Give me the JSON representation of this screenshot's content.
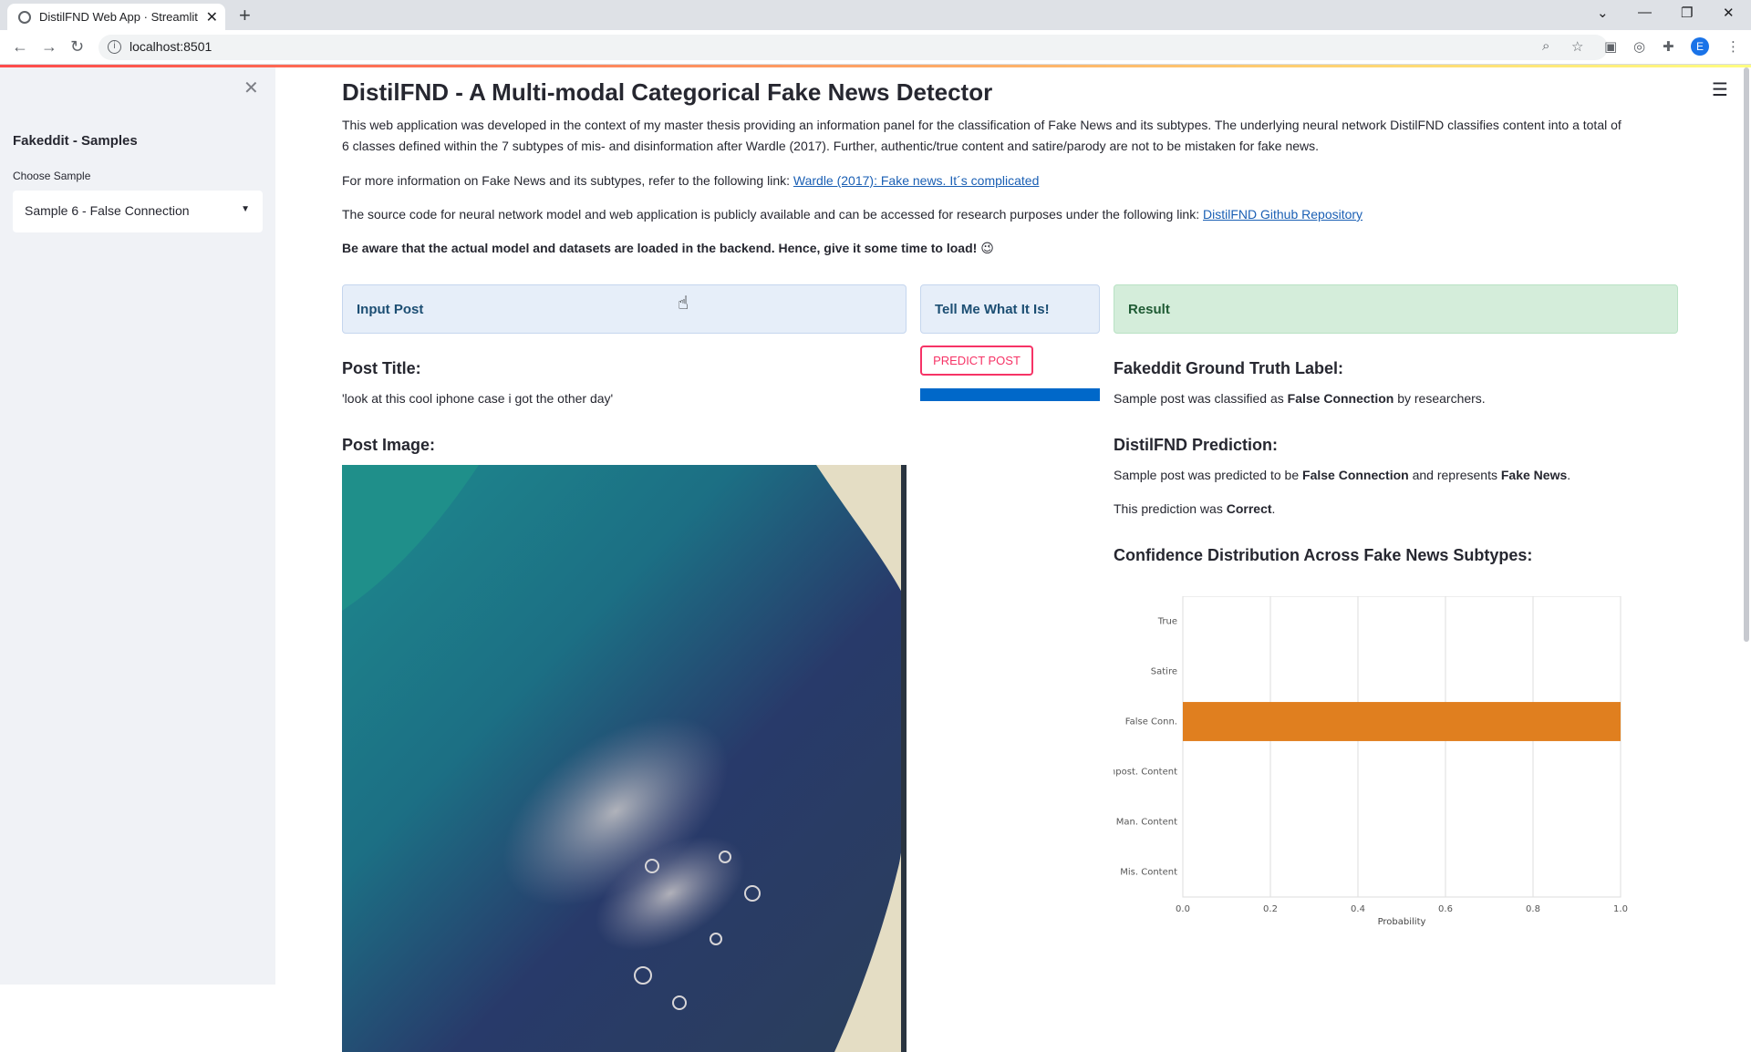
{
  "browser": {
    "tab_title": "DistilFND Web App · Streamlit",
    "url": "localhost:8501",
    "profile_initial": "E"
  },
  "sidebar": {
    "title": "Fakeddit - Samples",
    "select_label": "Choose Sample",
    "selected_value": "Sample 6 - False Connection"
  },
  "main": {
    "title": "DistilFND - A Multi-modal Categorical Fake News Detector",
    "intro_line1": "This web application was developed in the context of my master thesis providing an information panel for the classification of Fake News and its subtypes. The underlying neural network DistilFND classifies content into a total of",
    "intro_line2": "6 classes defined within the 7 subtypes of mis- and disinformation after Wardle (2017). Further, authentic/true content and satire/parody are not to be mistaken for fake news.",
    "more_info_text": "For more information on Fake News and its subtypes, refer to the following link:",
    "more_info_link": "Wardle (2017): Fake news. It´s complicated",
    "source_text": "The source code for neural network model and web application is publicly available and can be accessed for research purposes under the following link:",
    "source_link": "DistilFND Github Repository",
    "warning": "Be aware that the actual model and datasets are loaded in the backend. Hence, give it some time to load! 😉"
  },
  "panels": {
    "input": "Input Post",
    "tell": "Tell Me What It Is!",
    "result": "Result"
  },
  "post": {
    "title_heading": "Post Title:",
    "title_value": "'look at this cool iphone case i got the other day'",
    "image_heading": "Post Image:"
  },
  "predict": {
    "button_label": "PREDICT POST",
    "progress": 1.0
  },
  "result": {
    "truth_heading": "Fakeddit Ground Truth Label:",
    "truth_prefix": "Sample post was classified as ",
    "truth_label": "False Connection",
    "truth_suffix": " by researchers.",
    "prediction_heading": "DistilFND Prediction:",
    "pred_prefix": "Sample post was predicted to be ",
    "pred_label": "False Connection",
    "pred_mid": " and represents ",
    "pred_class": "Fake News",
    "pred_end": ".",
    "correct_prefix": "This prediction was ",
    "correct_value": "Correct",
    "correct_end": ".",
    "confidence_heading": "Confidence Distribution Across Fake News Subtypes:"
  },
  "chart_data": {
    "type": "bar",
    "orientation": "horizontal",
    "categories": [
      "True",
      "Satire",
      "False Conn.",
      "Impost. Content",
      "Man. Content",
      "Mis. Content"
    ],
    "values": [
      0.0,
      0.0,
      1.0,
      0.0,
      0.0,
      0.0
    ],
    "xlabel": "Probability",
    "ylabel": "",
    "xlim": [
      0.0,
      1.0
    ],
    "xticks": [
      "0.0",
      "0.2",
      "0.4",
      "0.6",
      "0.8",
      "1.0"
    ],
    "grid": true,
    "bar_color": "#e07f1f"
  }
}
